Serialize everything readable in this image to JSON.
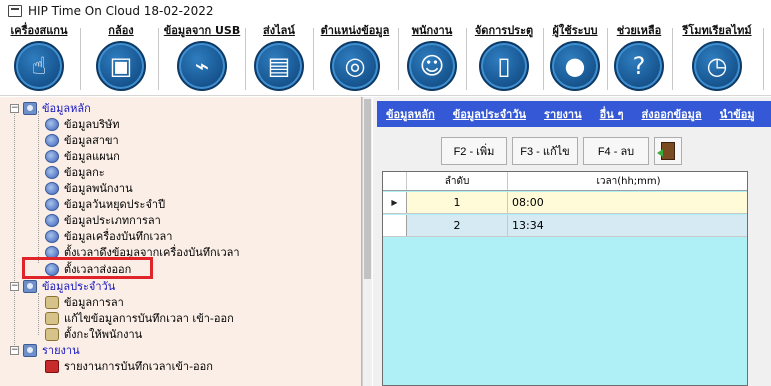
{
  "window": {
    "title": "HIP Time On Cloud  18-02-2022"
  },
  "toolbar": [
    {
      "label": "เครื่องสแกน",
      "icon": "hand-scan-icon",
      "glyph": "☝"
    },
    {
      "label": "กล้อง",
      "icon": "camera-icon",
      "glyph": "▣"
    },
    {
      "label": "ข้อมูลจาก USB",
      "icon": "usb-icon",
      "glyph": "⌁"
    },
    {
      "label": "ส่งไลน์",
      "icon": "send-line-icon",
      "glyph": "▤"
    },
    {
      "label": "ตำแหน่งข้อมูล",
      "icon": "database-icon",
      "glyph": "◎"
    },
    {
      "label": "พนักงาน",
      "icon": "employees-icon",
      "glyph": "☺"
    },
    {
      "label": "จัดการประตู",
      "icon": "door-icon",
      "glyph": "▯"
    },
    {
      "label": "ผู้ใช้ระบบ",
      "icon": "user-icon",
      "glyph": "●"
    },
    {
      "label": "ช่วยเหลือ",
      "icon": "help-icon",
      "glyph": "?"
    },
    {
      "label": "รีโมทเรียลไทม์",
      "icon": "remote-clock-icon",
      "glyph": "◷"
    }
  ],
  "tree": {
    "groups": [
      {
        "label": "ข้อมูลหลัก",
        "expander": "−"
      },
      {
        "label": "ข้อมูลประจำวัน",
        "expander": "−"
      },
      {
        "label": "รายงาน",
        "expander": "−"
      }
    ],
    "main_items": [
      "ข้อมูลบริษัท",
      "ข้อมูลสาขา",
      "ข้อมูลแผนก",
      "ข้อมูลกะ",
      "ข้อมูลพนักงาน",
      "ข้อมูลวันหยุดประจำปี",
      "ข้อมูลประเภทการลา",
      "ข้อมูลเครื่องบันทึกเวลา",
      "ตั้งเวลาดึงข้อมูลจากเครื่องบันทึกเวลา",
      "ตั้งเวลาส่งออก"
    ],
    "daily_items": [
      "ข้อมูลการลา",
      "แก้ไขข้อมูลการบันทึกเวลา เข้า-ออก",
      "ตั้งกะให้พนักงาน"
    ],
    "report_items": [
      "รายงานการบันทึกเวลาเข้า-ออก"
    ]
  },
  "menu": [
    "ข้อมูลหลัก",
    "ข้อมูลประจำวัน",
    "รายงาน",
    "อื่น ๆ",
    "ส่งออกข้อมูล",
    "นำข้อมู"
  ],
  "buttons": {
    "add": "F2 - เพิ่ม",
    "edit": "F3 - แก้ไข",
    "delete": "F4 - ลบ"
  },
  "grid": {
    "columns": [
      "ลำดับ",
      "เวลา(hh;mm)"
    ],
    "rows": [
      {
        "no": "1",
        "time": "08:00",
        "selected": true
      },
      {
        "no": "2",
        "time": "13:34",
        "selected": false
      }
    ]
  },
  "colors": {
    "menu_bg": "#3559d6",
    "tree_bg": "#faeee6",
    "grid_bg": "#aef0f5",
    "selected_row": "#fffbd8",
    "alt_row": "#d6eaf4",
    "highlight": "#e0252a"
  }
}
